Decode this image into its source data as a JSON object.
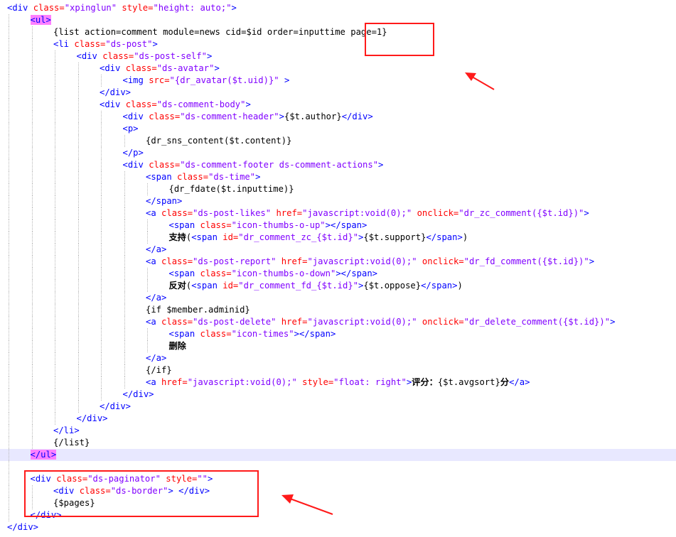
{
  "editor": {
    "lines": [
      {
        "indent": 0,
        "tokens": [
          {
            "t": "tag",
            "v": "<div "
          },
          {
            "t": "attr",
            "v": "class="
          },
          {
            "t": "val",
            "v": "\"xpinglun\""
          },
          {
            "t": "attr",
            "v": " style="
          },
          {
            "t": "val",
            "v": "\"height: auto;\""
          },
          {
            "t": "tag",
            "v": ">"
          }
        ]
      },
      {
        "indent": 1,
        "tokens": [
          {
            "t": "tagmatch",
            "v": "<ul>"
          }
        ]
      },
      {
        "indent": 2,
        "tokens": [
          {
            "t": "txt",
            "v": "{list action=comment module=news cid=$id order=inputtime page=1}"
          }
        ]
      },
      {
        "indent": 2,
        "tokens": [
          {
            "t": "tag",
            "v": "<li "
          },
          {
            "t": "attr",
            "v": "class="
          },
          {
            "t": "val",
            "v": "\"ds-post\""
          },
          {
            "t": "tag",
            "v": ">"
          }
        ]
      },
      {
        "indent": 3,
        "tokens": [
          {
            "t": "tag",
            "v": "<div "
          },
          {
            "t": "attr",
            "v": "class="
          },
          {
            "t": "val",
            "v": "\"ds-post-self\""
          },
          {
            "t": "tag",
            "v": ">"
          }
        ]
      },
      {
        "indent": 4,
        "tokens": [
          {
            "t": "tag",
            "v": "<div "
          },
          {
            "t": "attr",
            "v": "class="
          },
          {
            "t": "val",
            "v": "\"ds-avatar\""
          },
          {
            "t": "tag",
            "v": ">"
          }
        ]
      },
      {
        "indent": 5,
        "tokens": [
          {
            "t": "tag",
            "v": "<img "
          },
          {
            "t": "attr",
            "v": "src="
          },
          {
            "t": "val",
            "v": "\"{dr_avatar($t.uid)}\""
          },
          {
            "t": "tag",
            "v": " >"
          }
        ]
      },
      {
        "indent": 4,
        "tokens": [
          {
            "t": "tag",
            "v": "</div>"
          }
        ]
      },
      {
        "indent": 4,
        "tokens": [
          {
            "t": "tag",
            "v": "<div "
          },
          {
            "t": "attr",
            "v": "class="
          },
          {
            "t": "val",
            "v": "\"ds-comment-body\""
          },
          {
            "t": "tag",
            "v": ">"
          }
        ]
      },
      {
        "indent": 5,
        "tokens": [
          {
            "t": "tag",
            "v": "<div "
          },
          {
            "t": "attr",
            "v": "class="
          },
          {
            "t": "val",
            "v": "\"ds-comment-header\""
          },
          {
            "t": "tag",
            "v": ">"
          },
          {
            "t": "txt",
            "v": "{$t.author}"
          },
          {
            "t": "tag",
            "v": "</div>"
          }
        ]
      },
      {
        "indent": 5,
        "tokens": [
          {
            "t": "tag",
            "v": "<p>"
          }
        ]
      },
      {
        "indent": 6,
        "tokens": [
          {
            "t": "txt",
            "v": "{dr_sns_content($t.content)}"
          }
        ]
      },
      {
        "indent": 5,
        "tokens": [
          {
            "t": "tag",
            "v": "</p>"
          }
        ]
      },
      {
        "indent": 5,
        "tokens": [
          {
            "t": "tag",
            "v": "<div "
          },
          {
            "t": "attr",
            "v": "class="
          },
          {
            "t": "val",
            "v": "\"ds-comment-footer ds-comment-actions\""
          },
          {
            "t": "tag",
            "v": ">"
          }
        ]
      },
      {
        "indent": 6,
        "tokens": [
          {
            "t": "tag",
            "v": "<span "
          },
          {
            "t": "attr",
            "v": "class="
          },
          {
            "t": "val",
            "v": "\"ds-time\""
          },
          {
            "t": "tag",
            "v": ">"
          }
        ]
      },
      {
        "indent": 7,
        "tokens": [
          {
            "t": "txt",
            "v": "{dr_fdate($t.inputtime)}"
          }
        ]
      },
      {
        "indent": 6,
        "tokens": [
          {
            "t": "tag",
            "v": "</span>"
          }
        ]
      },
      {
        "indent": 6,
        "tokens": [
          {
            "t": "tag",
            "v": "<a "
          },
          {
            "t": "attr",
            "v": "class="
          },
          {
            "t": "val",
            "v": "\"ds-post-likes\""
          },
          {
            "t": "attr",
            "v": " href="
          },
          {
            "t": "val",
            "v": "\"javascript:void(0);\""
          },
          {
            "t": "attr",
            "v": " onclick="
          },
          {
            "t": "val",
            "v": "\"dr_zc_comment({$t.id})\""
          },
          {
            "t": "tag",
            "v": ">"
          }
        ]
      },
      {
        "indent": 7,
        "tokens": [
          {
            "t": "tag",
            "v": "<span "
          },
          {
            "t": "attr",
            "v": "class="
          },
          {
            "t": "val",
            "v": "\"icon-thumbs-o-up\""
          },
          {
            "t": "tag",
            "v": "></span>"
          }
        ]
      },
      {
        "indent": 7,
        "tokens": [
          {
            "t": "cjk",
            "v": "支持"
          },
          {
            "t": "txt",
            "v": "("
          },
          {
            "t": "tag",
            "v": "<span "
          },
          {
            "t": "attr",
            "v": "id="
          },
          {
            "t": "val",
            "v": "\"dr_comment_zc_{$t.id}\""
          },
          {
            "t": "tag",
            "v": ">"
          },
          {
            "t": "txt",
            "v": "{$t.support}"
          },
          {
            "t": "tag",
            "v": "</span>"
          },
          {
            "t": "txt",
            "v": ")"
          }
        ]
      },
      {
        "indent": 6,
        "tokens": [
          {
            "t": "tag",
            "v": "</a>"
          }
        ]
      },
      {
        "indent": 6,
        "tokens": [
          {
            "t": "tag",
            "v": "<a "
          },
          {
            "t": "attr",
            "v": "class="
          },
          {
            "t": "val",
            "v": "\"ds-post-report\""
          },
          {
            "t": "attr",
            "v": " href="
          },
          {
            "t": "val",
            "v": "\"javascript:void(0);\""
          },
          {
            "t": "attr",
            "v": " onclick="
          },
          {
            "t": "val",
            "v": "\"dr_fd_comment({$t.id})\""
          },
          {
            "t": "tag",
            "v": ">"
          }
        ]
      },
      {
        "indent": 7,
        "tokens": [
          {
            "t": "tag",
            "v": "<span "
          },
          {
            "t": "attr",
            "v": "class="
          },
          {
            "t": "val",
            "v": "\"icon-thumbs-o-down\""
          },
          {
            "t": "tag",
            "v": "></span>"
          }
        ]
      },
      {
        "indent": 7,
        "tokens": [
          {
            "t": "cjk",
            "v": "反对"
          },
          {
            "t": "txt",
            "v": "("
          },
          {
            "t": "tag",
            "v": "<span "
          },
          {
            "t": "attr",
            "v": "id="
          },
          {
            "t": "val",
            "v": "\"dr_comment_fd_{$t.id}\""
          },
          {
            "t": "tag",
            "v": ">"
          },
          {
            "t": "txt",
            "v": "{$t.oppose}"
          },
          {
            "t": "tag",
            "v": "</span>"
          },
          {
            "t": "txt",
            "v": ")"
          }
        ]
      },
      {
        "indent": 6,
        "tokens": [
          {
            "t": "tag",
            "v": "</a>"
          }
        ]
      },
      {
        "indent": 6,
        "tokens": [
          {
            "t": "txt",
            "v": "{if $member.adminid}"
          }
        ]
      },
      {
        "indent": 6,
        "tokens": [
          {
            "t": "tag",
            "v": "<a "
          },
          {
            "t": "attr",
            "v": "class="
          },
          {
            "t": "val",
            "v": "\"ds-post-delete\""
          },
          {
            "t": "attr",
            "v": " href="
          },
          {
            "t": "val",
            "v": "\"javascript:void(0);\""
          },
          {
            "t": "attr",
            "v": " onclick="
          },
          {
            "t": "val",
            "v": "\"dr_delete_comment({$t.id})\""
          },
          {
            "t": "tag",
            "v": ">"
          }
        ]
      },
      {
        "indent": 7,
        "tokens": [
          {
            "t": "tag",
            "v": "<span "
          },
          {
            "t": "attr",
            "v": "class="
          },
          {
            "t": "val",
            "v": "\"icon-times\""
          },
          {
            "t": "tag",
            "v": "></span>"
          }
        ]
      },
      {
        "indent": 7,
        "tokens": [
          {
            "t": "cjk",
            "v": "删除"
          }
        ]
      },
      {
        "indent": 6,
        "tokens": [
          {
            "t": "tag",
            "v": "</a>"
          }
        ]
      },
      {
        "indent": 6,
        "tokens": [
          {
            "t": "txt",
            "v": "{/if}"
          }
        ]
      },
      {
        "indent": 6,
        "tokens": [
          {
            "t": "tag",
            "v": "<a "
          },
          {
            "t": "attr",
            "v": "href="
          },
          {
            "t": "val",
            "v": "\"javascript:void(0);\""
          },
          {
            "t": "attr",
            "v": " style="
          },
          {
            "t": "val",
            "v": "\"float: right\""
          },
          {
            "t": "tag",
            "v": ">"
          },
          {
            "t": "cjk",
            "v": "评分："
          },
          {
            "t": "txt",
            "v": "{$t.avgsort}"
          },
          {
            "t": "cjk",
            "v": "分"
          },
          {
            "t": "tag",
            "v": "</a>"
          }
        ]
      },
      {
        "indent": 5,
        "tokens": [
          {
            "t": "tag",
            "v": "</div>"
          }
        ]
      },
      {
        "indent": 4,
        "tokens": [
          {
            "t": "tag",
            "v": "</div>"
          }
        ]
      },
      {
        "indent": 3,
        "tokens": [
          {
            "t": "tag",
            "v": "</div>"
          }
        ]
      },
      {
        "indent": 2,
        "tokens": [
          {
            "t": "tag",
            "v": "</li>"
          }
        ]
      },
      {
        "indent": 2,
        "tokens": [
          {
            "t": "txt",
            "v": "{/list}"
          }
        ]
      },
      {
        "indent": 1,
        "highlight": true,
        "tokens": [
          {
            "t": "tagmatch",
            "v": "</ul>"
          }
        ]
      },
      {
        "indent": 1,
        "tokens": []
      },
      {
        "indent": 1,
        "tokens": [
          {
            "t": "tag",
            "v": "<div "
          },
          {
            "t": "attr",
            "v": "class="
          },
          {
            "t": "val",
            "v": "\"ds-paginator\""
          },
          {
            "t": "attr",
            "v": " style="
          },
          {
            "t": "val",
            "v": "\"\""
          },
          {
            "t": "tag",
            "v": ">"
          }
        ]
      },
      {
        "indent": 2,
        "tokens": [
          {
            "t": "tag",
            "v": "<div "
          },
          {
            "t": "attr",
            "v": "class="
          },
          {
            "t": "val",
            "v": "\"ds-border\""
          },
          {
            "t": "tag",
            "v": "> </div>"
          }
        ]
      },
      {
        "indent": 2,
        "tokens": [
          {
            "t": "txt",
            "v": "{$pages}"
          }
        ]
      },
      {
        "indent": 1,
        "tokens": [
          {
            "t": "tag",
            "v": "</div>"
          }
        ]
      },
      {
        "indent": 0,
        "tokens": [
          {
            "t": "tag",
            "v": "</div>"
          }
        ]
      }
    ]
  },
  "colors": {
    "tag": "#0000ff",
    "attribute": "#ff0000",
    "value": "#8000ff",
    "tag_match_highlight": "#ff80ff",
    "current_line": "#e8e8ff",
    "annotation": "#ff1a1a"
  },
  "annotations": [
    {
      "target": "page=1"
    },
    {
      "target": "ds-paginator block"
    }
  ]
}
